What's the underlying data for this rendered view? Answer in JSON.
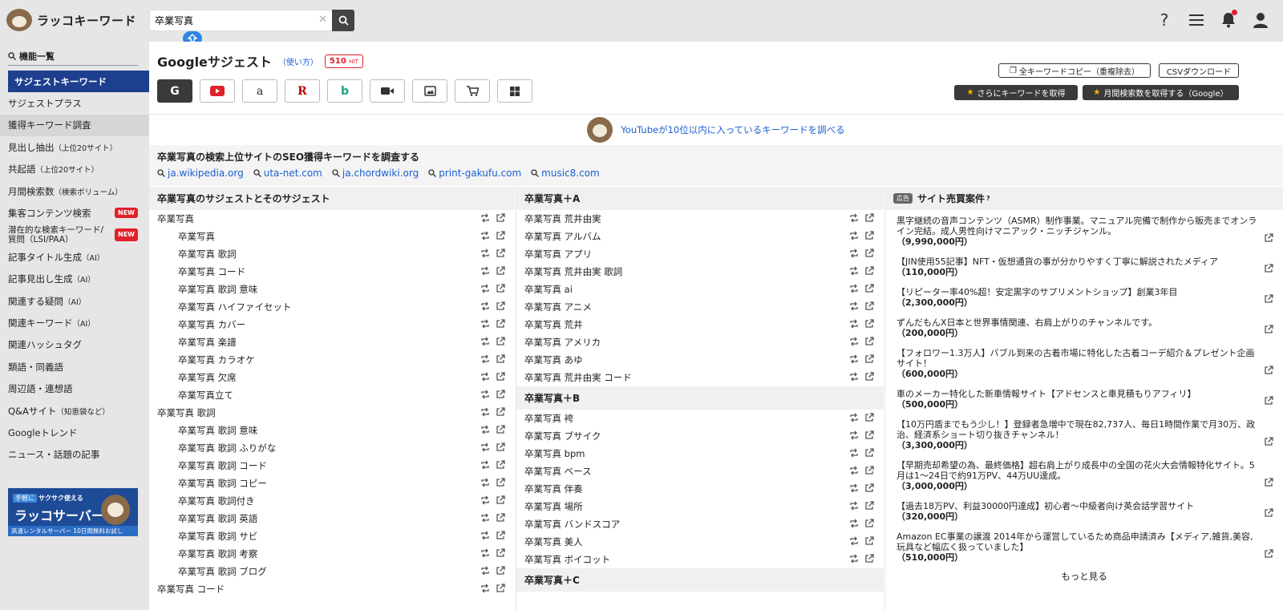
{
  "header": {
    "logo_text": "ラッコキーワード",
    "search_value": "卒業写真"
  },
  "sidebar": {
    "heading": "機能一覧",
    "items": [
      {
        "label": "サジェストキーワード",
        "sub": ""
      },
      {
        "label": "サジェストプラス",
        "sub": ""
      },
      {
        "label": "獲得キーワード調査",
        "sub": ""
      },
      {
        "label": "見出し抽出",
        "sub": "（上位20サイト）"
      },
      {
        "label": "共起語",
        "sub": "（上位20サイト）"
      },
      {
        "label": "月間検索数",
        "sub": "（検索ボリューム）"
      },
      {
        "label": "集客コンテンツ検索",
        "sub": ""
      },
      {
        "label": "潜在的な検索キーワード/",
        "sub": "質問（LSI/PAA）"
      },
      {
        "label": "記事タイトル生成",
        "sub": "（AI）"
      },
      {
        "label": "記事見出し生成",
        "sub": "（AI）"
      },
      {
        "label": "関連する疑問",
        "sub": "（AI）"
      },
      {
        "label": "関連キーワード",
        "sub": "（AI）"
      },
      {
        "label": "関連ハッシュタグ",
        "sub": ""
      },
      {
        "label": "類語・同義語",
        "sub": ""
      },
      {
        "label": "周辺語・連想語",
        "sub": ""
      },
      {
        "label": "Q&Aサイト",
        "sub": "（知恵袋など）"
      },
      {
        "label": "Googleトレンド",
        "sub": ""
      },
      {
        "label": "ニュース・話題の記事",
        "sub": ""
      }
    ],
    "new_badge": "NEW",
    "banner": {
      "tag1": "手軽に",
      "tag2": "サクサク使える",
      "title": "ラッコサーバー",
      "sub": "高速レンタルサーバー 10日間無料お試し"
    }
  },
  "main": {
    "title": "Googleサジェスト",
    "how_to": "（使い方）",
    "hit_count": "510",
    "hit_unit": "HIT",
    "copy_all": "全キーワードコピー（重複除去）",
    "csv": "CSVダウンロード",
    "get_more": "さらにキーワードを取得",
    "get_volume": "月間検索数を取得する（Google）",
    "youtube_link": "YouTubeが10位以内に入っているキーワードを調べる",
    "seo_title": "卒業写真の検索上位サイトのSEO獲得キーワードを調査する",
    "seo_sites": [
      "ja.wikipedia.org",
      "uta-net.com",
      "ja.chordwiki.org",
      "print-gakufu.com",
      "music8.com"
    ]
  },
  "col1": {
    "title": "卒業写真のサジェストとそのサジェスト",
    "rows": [
      {
        "t": "卒業写真",
        "sub": false
      },
      {
        "t": "卒業写真",
        "sub": true
      },
      {
        "t": "卒業写真 歌詞",
        "sub": true
      },
      {
        "t": "卒業写真 コード",
        "sub": true
      },
      {
        "t": "卒業写真 歌詞 意味",
        "sub": true
      },
      {
        "t": "卒業写真 ハイファイセット",
        "sub": true
      },
      {
        "t": "卒業写真 カバー",
        "sub": true
      },
      {
        "t": "卒業写真 楽譜",
        "sub": true
      },
      {
        "t": "卒業写真 カラオケ",
        "sub": true
      },
      {
        "t": "卒業写真 欠席",
        "sub": true
      },
      {
        "t": "卒業写真立て",
        "sub": true
      },
      {
        "t": "卒業写真 歌詞",
        "sub": false
      },
      {
        "t": "卒業写真 歌詞 意味",
        "sub": true
      },
      {
        "t": "卒業写真 歌詞 ふりがな",
        "sub": true
      },
      {
        "t": "卒業写真 歌詞 コード",
        "sub": true
      },
      {
        "t": "卒業写真 歌詞 コピー",
        "sub": true
      },
      {
        "t": "卒業写真 歌詞付き",
        "sub": true
      },
      {
        "t": "卒業写真 歌詞 英語",
        "sub": true
      },
      {
        "t": "卒業写真 歌詞 サビ",
        "sub": true
      },
      {
        "t": "卒業写真 歌詞 考察",
        "sub": true
      },
      {
        "t": "卒業写真 歌詞 ブログ",
        "sub": true
      },
      {
        "t": "卒業写真 コード",
        "sub": false
      }
    ]
  },
  "col2": {
    "groups": [
      {
        "title": "卒業写真＋A",
        "rows": [
          "卒業写真 荒井由実",
          "卒業写真 アルバム",
          "卒業写真 アプリ",
          "卒業写真 荒井由実 歌詞",
          "卒業写真 ai",
          "卒業写真 アニメ",
          "卒業写真 荒井",
          "卒業写真 アメリカ",
          "卒業写真 あゆ",
          "卒業写真 荒井由実 コード"
        ]
      },
      {
        "title": "卒業写真＋B",
        "rows": [
          "卒業写真 袴",
          "卒業写真 ブサイク",
          "卒業写真 bpm",
          "卒業写真 ベース",
          "卒業写真 伴奏",
          "卒業写真 場所",
          "卒業写真 バンドスコア",
          "卒業写真 美人",
          "卒業写真 ボイコット"
        ]
      },
      {
        "title": "卒業写真＋C",
        "rows": []
      }
    ]
  },
  "col3": {
    "ad_badge": "広告",
    "title": "サイト売買案件",
    "help": "?",
    "ads": [
      {
        "text": "黒字継続の音声コンテンツ（ASMR）制作事業。マニュアル完備で制作から販売までオンライン完結。成人男性向けマニアック・ニッチジャンル。",
        "price": "（9,990,000円）"
      },
      {
        "text": "【JIN使用55記事】NFT・仮想通貨の事が分かりやすく丁寧に解説されたメディア",
        "price": "（110,000円）"
      },
      {
        "text": "【リピーター率40%超！安定黒字のサプリメントショップ】創業3年目",
        "price": "（2,300,000円）"
      },
      {
        "text": "ずんだもんX日本と世界事情関連、右肩上がりのチャンネルです。",
        "price": "（200,000円）"
      },
      {
        "text": "【フォロワー1.3万人】バブル到来の古着市場に特化した古着コーデ紹介＆プレゼント企画サイト！",
        "price": "（600,000円）"
      },
      {
        "text": "車のメーカー特化した新車情報サイト【アドセンスと車見積もりアフィリ】",
        "price": "（500,000円）"
      },
      {
        "text": "【10万円盾までもう少し！】登録者急増中で現在82,737人、毎日1時間作業で月30万、政治、経済系ショート切り抜きチャンネル！",
        "price": "（3,300,000円）"
      },
      {
        "text": "【早期売却希望の為、最終価格】超右肩上がり成長中の全国の花火大会情報特化サイト。5月は1〜24日で約91万PV、44万UU達成。",
        "price": "（3,000,000円）"
      },
      {
        "text": "【過去18万PV、利益30000円達成】初心者〜中級者向け英会話学習サイト",
        "price": "（320,000円）"
      },
      {
        "text": "Amazon EC事業の譲渡 2014年から運営しているため商品申請済み【メディア,雑貨,美容,玩具など幅広く扱っていました】",
        "price": "（510,000円）"
      }
    ],
    "more": "もっと見る"
  }
}
